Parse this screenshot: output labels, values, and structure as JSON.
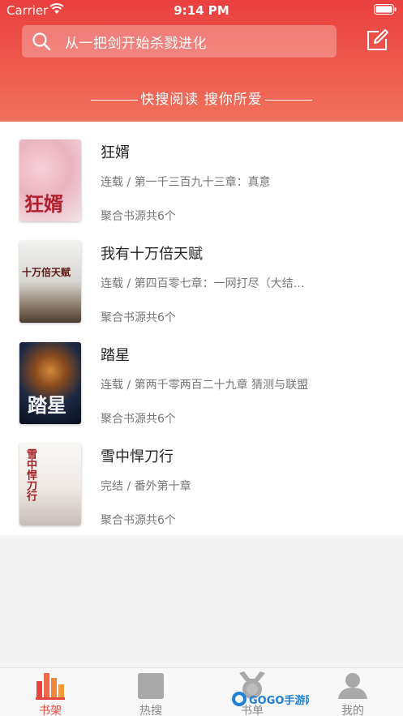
{
  "status": {
    "carrier": "Carrier",
    "time": "9:14 PM"
  },
  "search": {
    "placeholder": "从一把剑开始杀戮进化"
  },
  "slogan": "快搜阅读 搜你所爱",
  "books": [
    {
      "title": "狂婿",
      "chapter": "连载 / 第一千三百九十三章：真意",
      "source": "聚合书源共6个",
      "cover_text": "狂婿"
    },
    {
      "title": "我有十万倍天赋",
      "chapter": "连载 / 第四百零七章：一网打尽（大结…",
      "source": "聚合书源共6个",
      "cover_text": "十万倍天赋"
    },
    {
      "title": "踏星",
      "chapter": "连载 / 第两千零两百二十九章 猜测与联盟",
      "source": "聚合书源共6个",
      "cover_text": "踏星"
    },
    {
      "title": "雪中悍刀行",
      "chapter": "完结 / 番外第十章",
      "source": "聚合书源共6个",
      "cover_text": "雪中悍刀行"
    }
  ],
  "tabs": [
    {
      "label": "书架",
      "icon": "bookshelf-icon",
      "active": true
    },
    {
      "label": "热搜",
      "icon": "hot-search-icon",
      "active": false
    },
    {
      "label": "书单",
      "icon": "medal-icon",
      "active": false
    },
    {
      "label": "我的",
      "icon": "user-icon",
      "active": false
    }
  ],
  "watermark": "GOGO手游网",
  "colors": {
    "accent": "#e8453c",
    "header_top": "#ea3f3f",
    "header_bottom": "#f0715c"
  }
}
